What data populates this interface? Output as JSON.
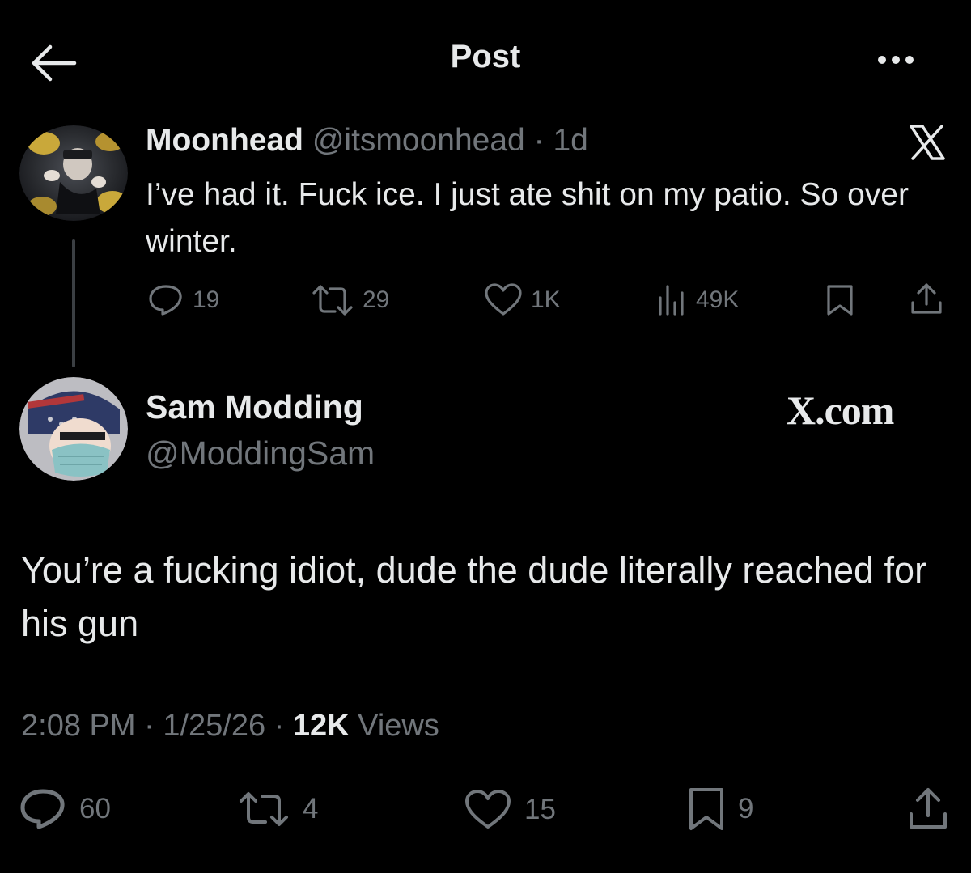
{
  "header": {
    "title": "Post",
    "back_icon": "arrow-left-icon",
    "more_icon": "more-horizontal-icon"
  },
  "parent_post": {
    "author_name": "Moonhead",
    "handle": "@itsmoonhead",
    "separator": "·",
    "time_ago": "1d",
    "text": "I’ve had it. Fuck ice. I just ate shit on my patio. So over winter.",
    "stats": {
      "replies": "19",
      "reposts": "29",
      "likes": "1K",
      "views": "49K"
    }
  },
  "reply_post": {
    "author_name": "Sam Modding",
    "handle": "@ModdingSam",
    "watermark": "X.com",
    "text": "You’re a fucking idiot, dude the dude literally reached for his gun",
    "time": "2:08 PM",
    "date": "1/25/26",
    "views_count": "12K",
    "views_label": "Views",
    "stats": {
      "replies": "60",
      "reposts": "4",
      "likes": "15",
      "bookmarks": "9"
    }
  },
  "colors": {
    "background": "#000000",
    "primary_text": "#e7e9ea",
    "secondary_text": "#71767b",
    "thread_line": "#3b3f43"
  }
}
